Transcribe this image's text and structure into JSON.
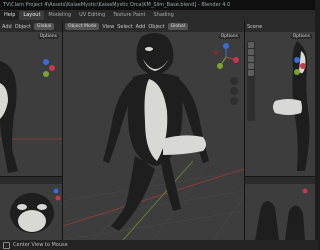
{
  "window_title": "TV\\Clam Project 4\\Assets\\KalaeMystic\\KalaeMystic Orca\\KM_Slim_Base.blend] - Blender 4.0",
  "workspace_tabs": [
    "Help",
    "Layout",
    "Modeling",
    "UV Editing",
    "Texture Paint",
    "Shading"
  ],
  "left_header": {
    "add": "Add",
    "object": "Object",
    "global": "Global",
    "options": "Options"
  },
  "center_header": {
    "mode": "Object Mode",
    "view": "View",
    "select": "Select",
    "add": "Add",
    "object": "Object",
    "global": "Global",
    "options": "Options"
  },
  "right_header": {
    "scene": "Scene",
    "options": "Options"
  },
  "status_bar": {
    "hint": "Center View to Mouse"
  },
  "colors": {
    "viewport_bg": "#3d3d3d",
    "header_bg": "#2b2b2b",
    "model_dark": "#1e1e1f",
    "model_light": "#d8d8d4",
    "grid_red": "#9b3a3a",
    "grid_green": "#6e8c2c"
  }
}
